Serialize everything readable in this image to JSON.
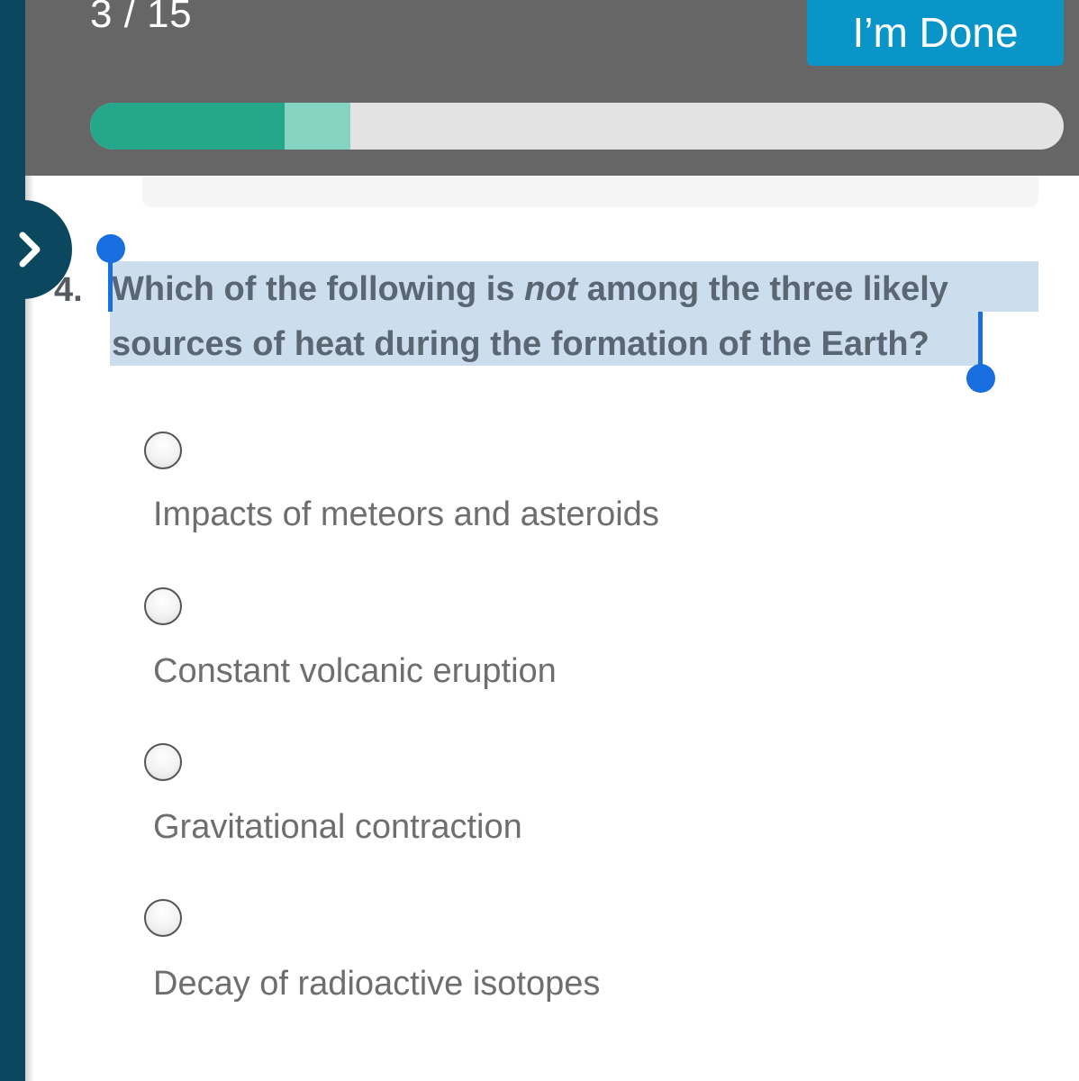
{
  "header": {
    "counter": "3 / 15",
    "done_label": "I’m Done"
  },
  "progress": {
    "completed_fraction": 0.2,
    "current_fraction": 0.067
  },
  "question": {
    "number": "4.",
    "text_before": "Which of the following is ",
    "text_emphasis": "not",
    "text_after_line1": " among the three likely",
    "text_line2": "sources of heat during the formation of the Earth?"
  },
  "answers": [
    {
      "label": "Impacts of meteors and asteroids"
    },
    {
      "label": "Constant volcanic eruption"
    },
    {
      "label": "Gravitational contraction"
    },
    {
      "label": "Decay of radioactive isotopes"
    }
  ],
  "colors": {
    "header_bg": "#666666",
    "done_button": "#0a95c9",
    "progress_done": "#25a88a",
    "progress_current": "#85d4c2",
    "side_rail": "#0b4860",
    "selection_highlight": "#ccdded",
    "selection_handle": "#1a6fe0"
  },
  "icons": {
    "drawer_toggle": "chevron-right-icon"
  }
}
